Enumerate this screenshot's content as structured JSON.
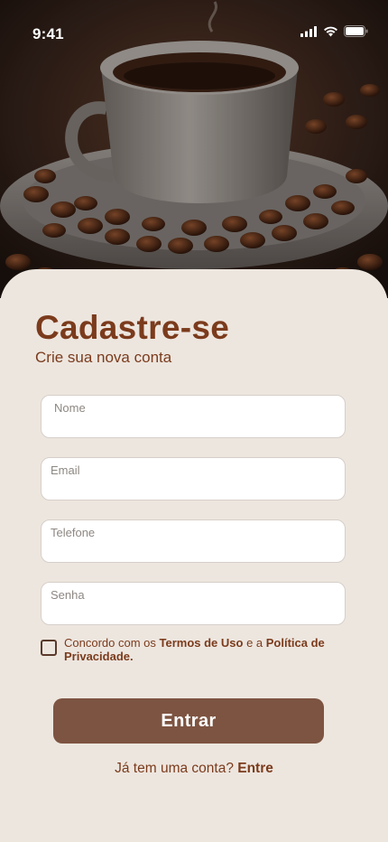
{
  "status_bar": {
    "time": "9:41",
    "icons": [
      "cellular-signal-icon",
      "wifi-icon",
      "battery-icon"
    ]
  },
  "hero": {
    "image": "coffee-cup-photo"
  },
  "form": {
    "title": "Cadastre-se",
    "subtitle": "Crie sua nova conta",
    "fields": [
      {
        "label": "Nome",
        "value": ""
      },
      {
        "label": "Email",
        "value": ""
      },
      {
        "label": "Telefone",
        "value": ""
      },
      {
        "label": "Senha",
        "value": ""
      }
    ],
    "terms": {
      "checked": false,
      "prefix": "Concordo com os ",
      "terms_link": "Termos de Uso",
      "middle": " e a ",
      "privacy_link": "Política de Privacidade."
    },
    "submit_label": "Entrar",
    "login_prompt": "Já tem uma conta? ",
    "login_link": "Entre"
  },
  "colors": {
    "accent": "#7b3b1c",
    "button": "#7d5441",
    "background": "#ede6df"
  }
}
